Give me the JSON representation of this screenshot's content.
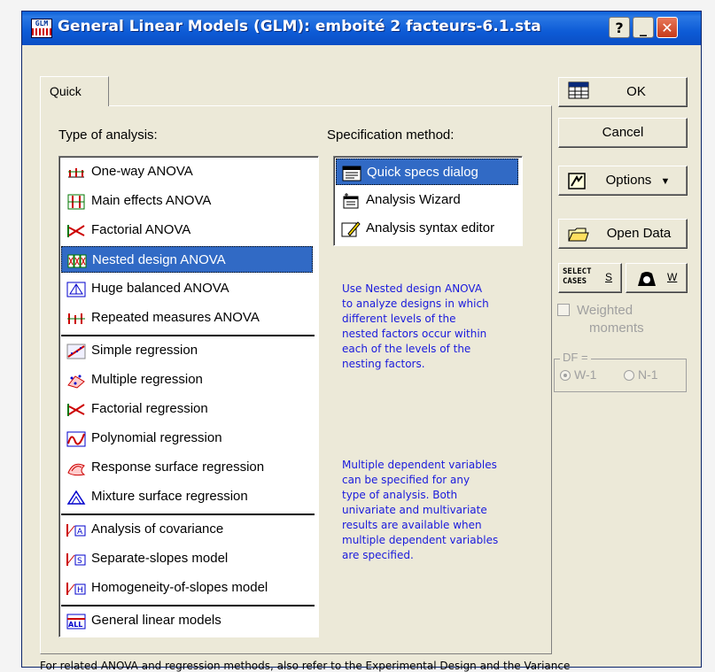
{
  "window": {
    "title": "General Linear Models (GLM): emboité 2 facteurs-6.1.sta",
    "icon_text": "GLM",
    "help": "?",
    "minimize": "_",
    "close": "✕"
  },
  "tabs": [
    {
      "label": "Quick",
      "selected": true
    }
  ],
  "analysis": {
    "label": "Type of analysis:",
    "groups": [
      [
        {
          "label": "One-way ANOVA",
          "icon": "one-way-anova-icon"
        },
        {
          "label": "Main effects ANOVA",
          "icon": "main-effects-anova-icon"
        },
        {
          "label": "Factorial ANOVA",
          "icon": "factorial-anova-icon"
        },
        {
          "label": "Nested design ANOVA",
          "icon": "nested-design-anova-icon",
          "selected": true
        },
        {
          "label": "Huge balanced ANOVA",
          "icon": "huge-balanced-anova-icon"
        },
        {
          "label": "Repeated measures ANOVA",
          "icon": "repeated-measures-anova-icon"
        }
      ],
      [
        {
          "label": "Simple regression",
          "icon": "simple-regression-icon"
        },
        {
          "label": "Multiple regression",
          "icon": "multiple-regression-icon"
        },
        {
          "label": "Factorial regression",
          "icon": "factorial-regression-icon"
        },
        {
          "label": "Polynomial regression",
          "icon": "polynomial-regression-icon"
        },
        {
          "label": "Response surface regression",
          "icon": "response-surface-regression-icon"
        },
        {
          "label": "Mixture surface regression",
          "icon": "mixture-surface-regression-icon"
        }
      ],
      [
        {
          "label": "Analysis of covariance",
          "icon": "covariance-icon"
        },
        {
          "label": "Separate-slopes model",
          "icon": "separate-slopes-icon"
        },
        {
          "label": "Homogeneity-of-slopes model",
          "icon": "homogeneity-slopes-icon"
        }
      ],
      [
        {
          "label": "General linear models",
          "icon": "general-linear-models-icon"
        }
      ]
    ]
  },
  "spec": {
    "label": "Specification method:",
    "items": [
      {
        "label": "Quick specs dialog",
        "icon": "quick-specs-icon",
        "selected": true
      },
      {
        "label": "Analysis Wizard",
        "icon": "wizard-icon"
      },
      {
        "label": "Analysis syntax editor",
        "icon": "syntax-editor-icon"
      }
    ]
  },
  "info": {
    "nested": [
      "Use Nested design ANOVA",
      "to analyze designs in which",
      "different levels of the",
      "nested factors occur within",
      "each of the levels of the",
      "nesting factors."
    ],
    "multiple": [
      "Multiple dependent variables",
      "can be specified for any",
      "type of analysis.  Both",
      "univariate and multivariate",
      "results are available when",
      "multiple dependent variables",
      "are specified."
    ]
  },
  "buttons": {
    "ok": "OK",
    "cancel": "Cancel",
    "options": "Options",
    "open_data": "Open Data",
    "select_cases_line1": "SELECT",
    "select_cases_line2": "CASES",
    "select_cases_key": "S",
    "weight_key": "W"
  },
  "weighted": {
    "line1": "Weighted",
    "line2": "moments",
    "checked": false
  },
  "df": {
    "label": "DF =",
    "options": [
      "W-1",
      "N-1"
    ],
    "selected": "W-1"
  },
  "footer": "For related ANOVA and regression methods, also refer to the Experimental Design and the Variance"
}
